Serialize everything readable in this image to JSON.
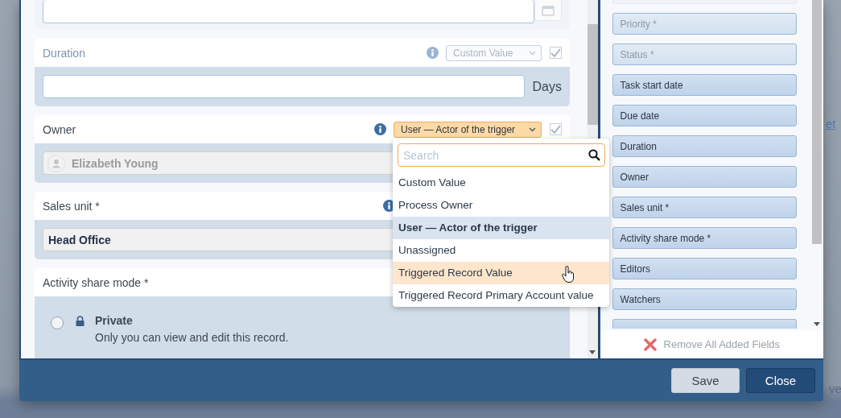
{
  "background": {
    "link": "et",
    "text": "ve"
  },
  "fields": [
    {
      "kind": "number",
      "label": "Duration",
      "disabled": true,
      "source": {
        "label": "Custom Value",
        "open": false
      },
      "checked": true,
      "unit": "Days"
    },
    {
      "kind": "user",
      "label": "Owner",
      "disabled": false,
      "source": {
        "label": "User — Actor of the trigger",
        "open": true
      },
      "checked": true,
      "value": "Elizabeth Young"
    },
    {
      "kind": "select",
      "label": "Sales unit *",
      "disabled": false,
      "value": "Head Office"
    },
    {
      "kind": "share",
      "label": "Activity share mode *",
      "disabled": false,
      "options": [
        {
          "title": "Private",
          "description": "Only you can view and edit this record.",
          "selected": false
        }
      ]
    }
  ],
  "dropdown": {
    "placeholder": "Search",
    "items": [
      {
        "label": "Custom Value",
        "selected": false,
        "hovered": false
      },
      {
        "label": "Process Owner",
        "selected": false,
        "hovered": false
      },
      {
        "label": "User — Actor of the trigger",
        "selected": true,
        "hovered": false
      },
      {
        "label": "Unassigned",
        "selected": false,
        "hovered": false
      },
      {
        "label": "Triggered Record Value",
        "selected": false,
        "hovered": true
      },
      {
        "label": "Triggered Record Primary Account value",
        "selected": false,
        "hovered": false
      }
    ]
  },
  "added_fields": [
    {
      "label": "Priority *",
      "disabled": true
    },
    {
      "label": "Status *",
      "disabled": true
    },
    {
      "label": "Task start date",
      "disabled": false
    },
    {
      "label": "Due date",
      "disabled": false
    },
    {
      "label": "Duration",
      "disabled": false
    },
    {
      "label": "Owner",
      "disabled": false
    },
    {
      "label": "Sales unit *",
      "disabled": false
    },
    {
      "label": "Activity share mode *",
      "disabled": false
    },
    {
      "label": "Editors",
      "disabled": false
    },
    {
      "label": "Watchers",
      "disabled": false
    }
  ],
  "remove_all": "Remove All Added Fields",
  "buttons": [
    {
      "label": "Save",
      "kind": "secondary"
    },
    {
      "label": "Close",
      "kind": "primary"
    }
  ]
}
